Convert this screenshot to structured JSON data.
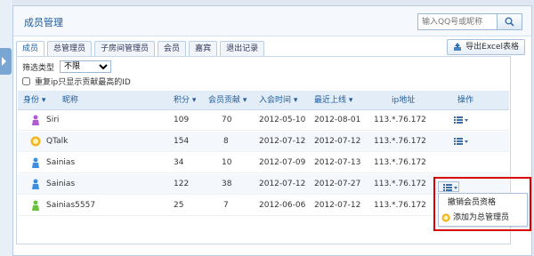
{
  "header": {
    "title": "成员管理",
    "search_placeholder": "输入QQ号或昵称"
  },
  "tabs": [
    {
      "label": "成员",
      "active": true
    },
    {
      "label": "总管理员"
    },
    {
      "label": "子房间管理员"
    },
    {
      "label": "会员"
    },
    {
      "label": "嘉宾"
    },
    {
      "label": "退出记录"
    }
  ],
  "export_label": "导出Excel表格",
  "filter": {
    "label": "筛选类型",
    "selected": "不限"
  },
  "checkbox_label": "重复ip只显示贡献最高的ID",
  "columns": {
    "sf": "身份",
    "name": "昵称",
    "jf": "积分",
    "gx": "会员贡献",
    "rh": "入会时间",
    "zj": "最近上线",
    "ip": "ip地址",
    "op": "操作"
  },
  "rows": [
    {
      "name": "Siri",
      "score": "109",
      "contrib": "70",
      "joined": "2012-05-10",
      "last": "2012-08-01",
      "ip": "113.*.76.172",
      "badge": "purple-person-icon"
    },
    {
      "name": "QTalk",
      "score": "154",
      "contrib": "8",
      "joined": "2012-07-12",
      "last": "2012-07-12",
      "ip": "113.*.76.172",
      "badge": "gold-crown-icon"
    },
    {
      "name": "Sainias",
      "score": "34",
      "contrib": "10",
      "joined": "2012-07-09",
      "last": "2012-07-13",
      "ip": "113.*.76.172",
      "badge": "blue-person-icon"
    },
    {
      "name": "Sainias",
      "score": "122",
      "contrib": "38",
      "joined": "2012-07-12",
      "last": "2012-07-27",
      "ip": "113.*.76.172",
      "badge": "blue-person-icon"
    },
    {
      "name": "Sainias5557",
      "score": "25",
      "contrib": "7",
      "joined": "2012-06-06",
      "last": "2012-07-12",
      "ip": "113.*.76.172",
      "badge": "green-person-icon"
    }
  ],
  "dropdown": {
    "items": [
      "撤销会员资格",
      "添加为总管理员"
    ]
  },
  "colors": {
    "accent": "#1f5c99",
    "highlight": "#d80000"
  }
}
